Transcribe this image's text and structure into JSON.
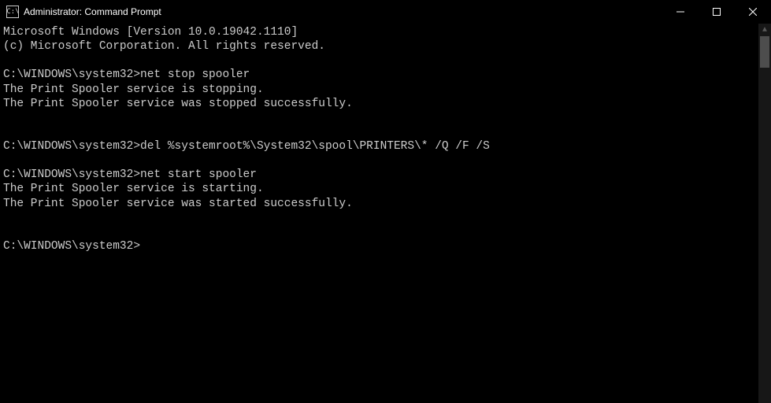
{
  "window": {
    "title": "Administrator: Command Prompt"
  },
  "terminal": {
    "lines": [
      "Microsoft Windows [Version 10.0.19042.1110]",
      "(c) Microsoft Corporation. All rights reserved.",
      "",
      "C:\\WINDOWS\\system32>net stop spooler",
      "The Print Spooler service is stopping.",
      "The Print Spooler service was stopped successfully.",
      "",
      "",
      "C:\\WINDOWS\\system32>del %systemroot%\\System32\\spool\\PRINTERS\\* /Q /F /S",
      "",
      "C:\\WINDOWS\\system32>net start spooler",
      "The Print Spooler service is starting.",
      "The Print Spooler service was started successfully.",
      "",
      "",
      "C:\\WINDOWS\\system32>"
    ]
  }
}
